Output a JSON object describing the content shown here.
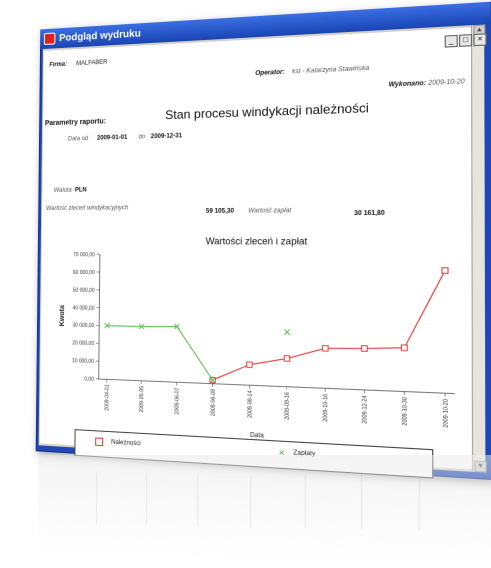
{
  "window": {
    "title": "Podgląd wydruku",
    "buttons": [
      "_",
      "□",
      "×"
    ]
  },
  "report": {
    "firma_label": "Firma:",
    "firma_value": "MALFABER",
    "operator_label": "Operator:",
    "operator_value": "kst - Katarzyna Stawińska",
    "wykonano_label": "Wykonano:",
    "wykonano_value": "2009-10-20",
    "title": "Stan procesu windykacji należności",
    "params_label": "Parametry raportu:",
    "date_from_label": "Data od",
    "date_from": "2009-01-01",
    "date_to_label": "do",
    "date_to": "2009-12-31",
    "currency_label": "Waluta",
    "currency_value": "PLN",
    "orders_label": "Wartość zleceń windykacyjnych",
    "orders_value": "59 105,30",
    "payments_label": "Wartość zapłat",
    "payments_value": "30 161,80"
  },
  "chart_data": {
    "type": "line",
    "title": "Wartości zleceń i zapłat",
    "xlabel": "Data",
    "ylabel": "Kwota",
    "ylim": [
      0,
      70000
    ],
    "y_ticks": [
      "0,00",
      "10 000,00",
      "20 000,00",
      "30 000,00",
      "40 000,00",
      "50 000,00",
      "60 000,00",
      "70 000,00"
    ],
    "categories": [
      "2009-04-01",
      "2009-05-05",
      "2009-06-07",
      "2009-06-09",
      "2009-08-14",
      "2009-09-16",
      "2009-10-16",
      "2009-12-24",
      "2009-10-30",
      "2009-10-20"
    ],
    "series": [
      {
        "name": "Należności",
        "color": "#e53a3a",
        "values": [
          null,
          null,
          null,
          2000,
          11000,
          15000,
          21000,
          21500,
          22500,
          62500
        ]
      },
      {
        "name": "Zapłaty",
        "color": "#55b94a",
        "values": [
          30000,
          30000,
          30500,
          2000,
          null,
          29000,
          null,
          null,
          null,
          null
        ]
      }
    ],
    "legend_position": "bottom"
  }
}
